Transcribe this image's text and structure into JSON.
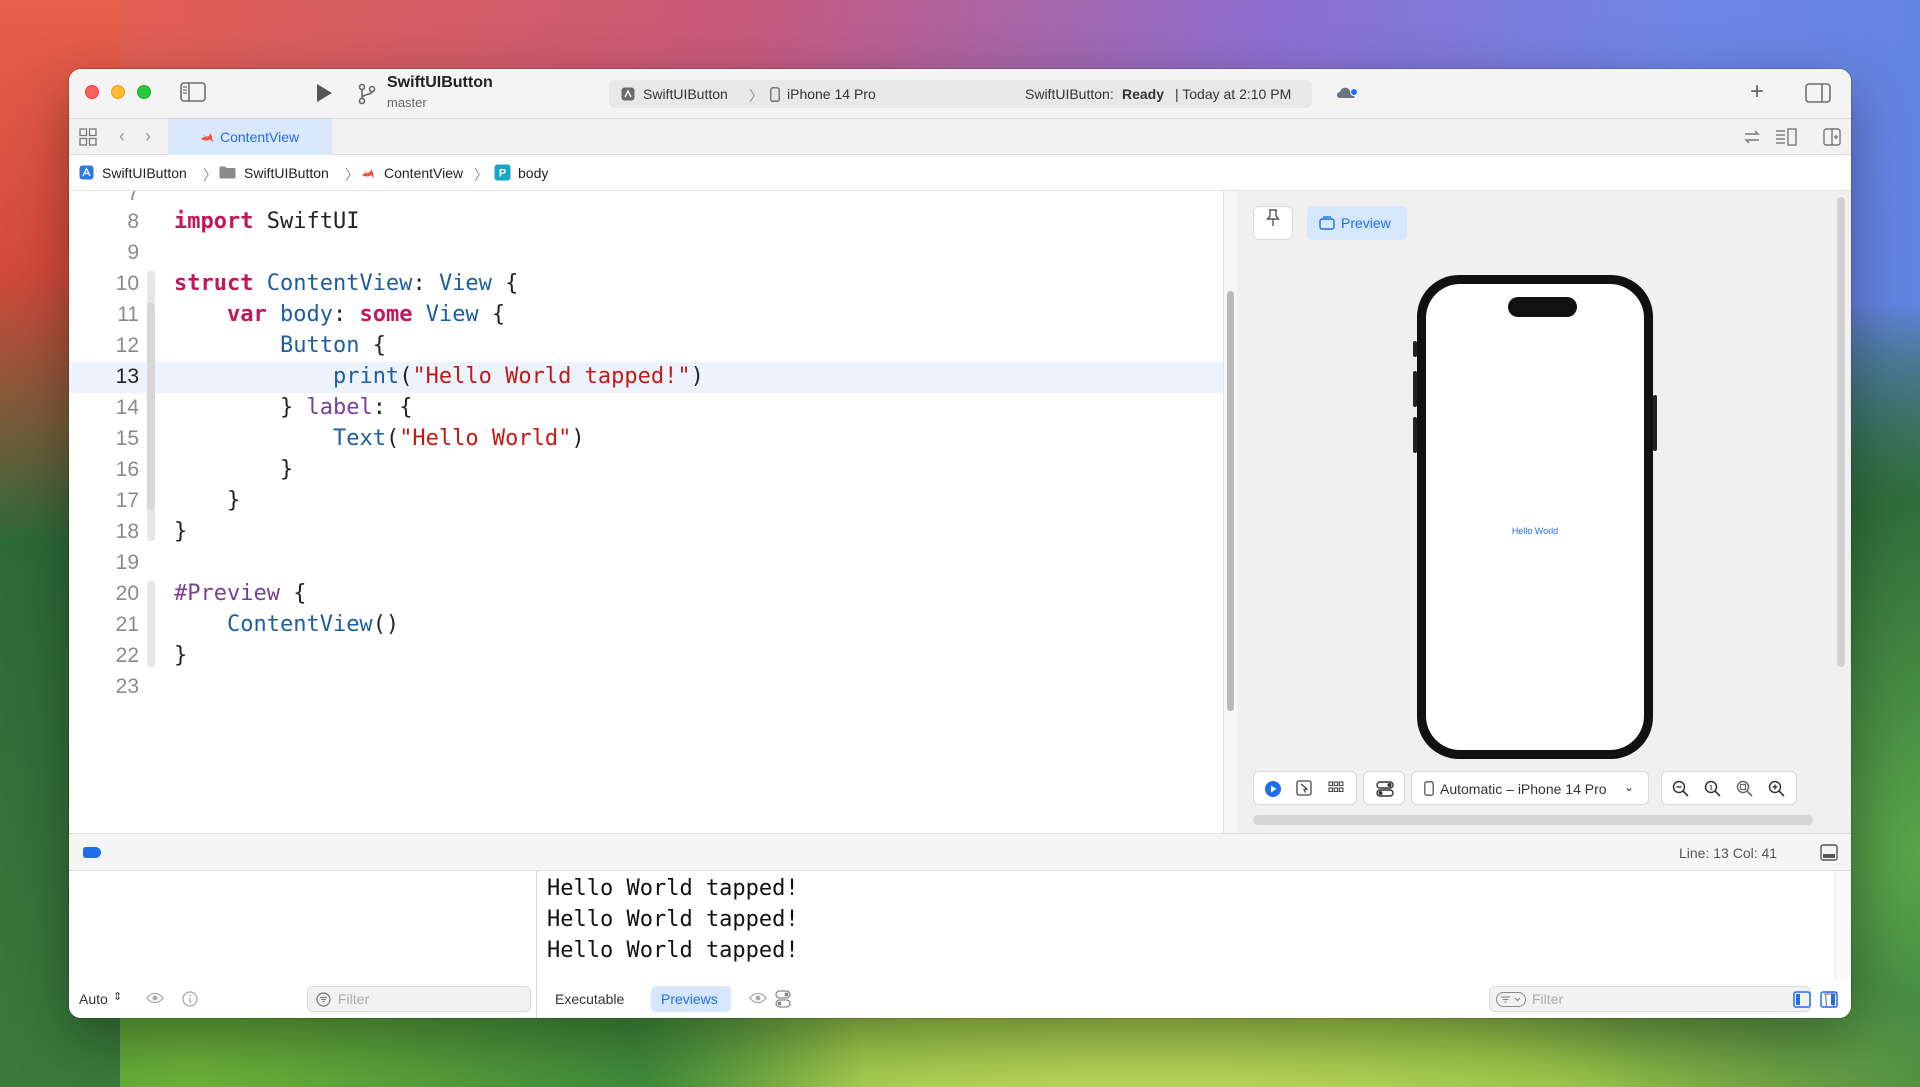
{
  "toolbar": {
    "project_name": "SwiftUIButton",
    "branch": "master",
    "scheme": "SwiftUIButton",
    "destination": "iPhone 14 Pro",
    "status_prefix": "SwiftUIButton:",
    "status_state": "Ready",
    "status_time": "| Today at 2:10 PM"
  },
  "tabs": [
    {
      "label": "ContentView",
      "active": true
    }
  ],
  "breadcrumb": [
    "SwiftUIButton",
    "SwiftUIButton",
    "ContentView",
    "body"
  ],
  "editor": {
    "first_partial_line": "7",
    "lines": [
      {
        "n": "8"
      },
      {
        "n": "9"
      },
      {
        "n": "10"
      },
      {
        "n": "11"
      },
      {
        "n": "12"
      },
      {
        "n": "13"
      },
      {
        "n": "14"
      },
      {
        "n": "15"
      },
      {
        "n": "16"
      },
      {
        "n": "17"
      },
      {
        "n": "18"
      },
      {
        "n": "19"
      },
      {
        "n": "20"
      },
      {
        "n": "21"
      },
      {
        "n": "22"
      },
      {
        "n": "23"
      }
    ],
    "current_line": "13",
    "code": {
      "l8_kw": "import",
      "l8_rest": " SwiftUI",
      "l10_kw": "struct",
      "l10_name": " ContentView",
      "l10_colon": ": ",
      "l10_type": "View",
      "l10_brace": " {",
      "l11_indent": "    ",
      "l11_kw": "var",
      "l11_name": " body",
      "l11_colon": ": ",
      "l11_kw2": "some",
      "l11_type": " View",
      "l11_brace": " {",
      "l12_indent": "        ",
      "l12_type": "Button",
      "l12_brace": " {",
      "l13_indent": "            ",
      "l13_fn": "print",
      "l13_open": "(",
      "l13_str": "\"Hello World tapped!\"",
      "l13_close": ")",
      "l14_indent": "        ",
      "l14_close": "} ",
      "l14_label": "label",
      "l14_rest": ": {",
      "l15_indent": "            ",
      "l15_type": "Text",
      "l15_open": "(",
      "l15_str": "\"Hello World\"",
      "l15_close": ")",
      "l16": "        }",
      "l17": "    }",
      "l18": "}",
      "l20_pp": "#Preview",
      "l20_brace": " {",
      "l21_indent": "    ",
      "l21_type": "ContentView",
      "l21_rest": "()",
      "l22": "}"
    }
  },
  "canvas": {
    "preview_label": "Preview",
    "phone_text": "Hello World",
    "device_menu": "Automatic – iPhone 14 Pro"
  },
  "debugbar": {
    "line_col": "Line: 13  Col: 41"
  },
  "variables_pane": {
    "scope": "Auto",
    "filter_placeholder": "Filter"
  },
  "console": {
    "output": [
      "Hello World tapped!",
      "Hello World tapped!",
      "Hello World tapped!"
    ],
    "tab_executable": "Executable",
    "tab_previews": "Previews",
    "filter_placeholder": "Filter"
  },
  "colors": {
    "accent": "#1f6feb",
    "keyword": "#c2185b",
    "string": "#c41a16",
    "type": "#1d5e9e"
  }
}
